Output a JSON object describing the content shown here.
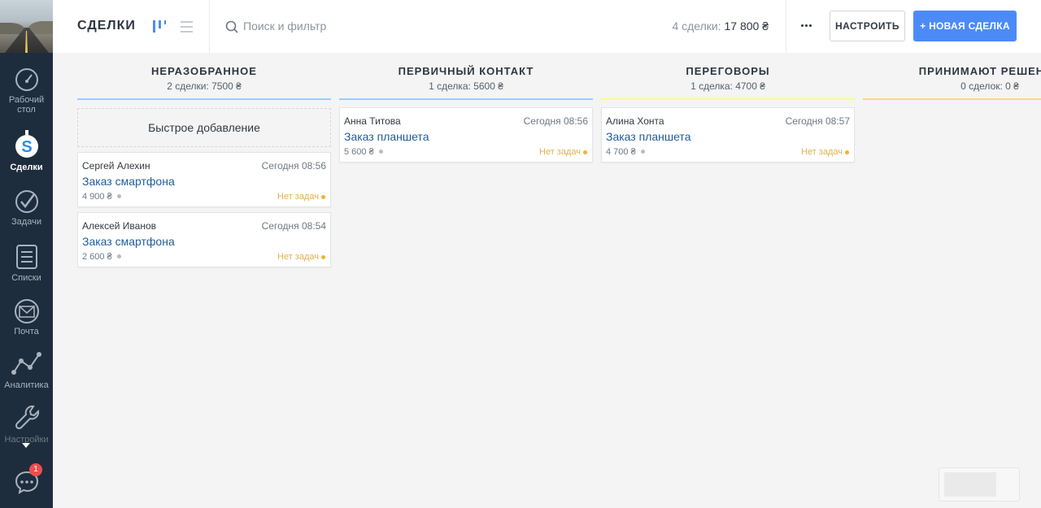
{
  "sidebar": {
    "items": [
      {
        "label": "Рабочий стол",
        "icon": "speedometer-icon"
      },
      {
        "label": "Сделки",
        "icon": "dollar-icon",
        "active": true
      },
      {
        "label": "Задачи",
        "icon": "check-icon"
      },
      {
        "label": "Списки",
        "icon": "list-icon"
      },
      {
        "label": "Почта",
        "icon": "mail-icon"
      },
      {
        "label": "Аналитика",
        "icon": "analytics-icon"
      },
      {
        "label": "Настройки",
        "icon": "wrench-icon"
      }
    ],
    "chat_badge": "1"
  },
  "header": {
    "title": "СДЕЛКИ",
    "search_placeholder": "Поиск и фильтр",
    "summary_label": "4 сделки:",
    "summary_amount": "17 800 ₴",
    "setup_button": "НАСТРОИТЬ",
    "new_deal_button": "+ НОВАЯ СДЕЛКА"
  },
  "pipeline": {
    "quick_add_label": "Быстрое добавление",
    "columns": [
      {
        "name": "НЕРАЗОБРАННОЕ",
        "summary": "2 сделки: 7500 ₴",
        "color": "#99ccfd",
        "cards": [
          {
            "contact": "Сергей Алехин",
            "date": "Сегодня 08:56",
            "title": "Заказ смартфона",
            "price": "4 900 ₴",
            "tasks": "Нет задач"
          },
          {
            "contact": "Алексей Иванов",
            "date": "Сегодня 08:54",
            "title": "Заказ смартфона",
            "price": "2 600 ₴",
            "tasks": "Нет задач"
          }
        ]
      },
      {
        "name": "ПЕРВИЧНЫЙ КОНТАКТ",
        "summary": "1 сделка: 5600 ₴",
        "color": "#99ccfd",
        "cards": [
          {
            "contact": "Анна Титова",
            "date": "Сегодня 08:56",
            "title": "Заказ планшета",
            "price": "5 600 ₴",
            "tasks": "Нет задач"
          }
        ]
      },
      {
        "name": "ПЕРЕГОВОРЫ",
        "summary": "1 сделка: 4700 ₴",
        "color": "#fffd7f",
        "cards": [
          {
            "contact": "Алина Хонта",
            "date": "Сегодня 08:57",
            "title": "Заказ планшета",
            "price": "4 700 ₴",
            "tasks": "Нет задач"
          }
        ]
      },
      {
        "name": "ПРИНИМАЮТ РЕШЕНИЕ",
        "summary": "0 сделок: 0 ₴",
        "color": "#fcd77a",
        "cards": []
      }
    ]
  }
}
